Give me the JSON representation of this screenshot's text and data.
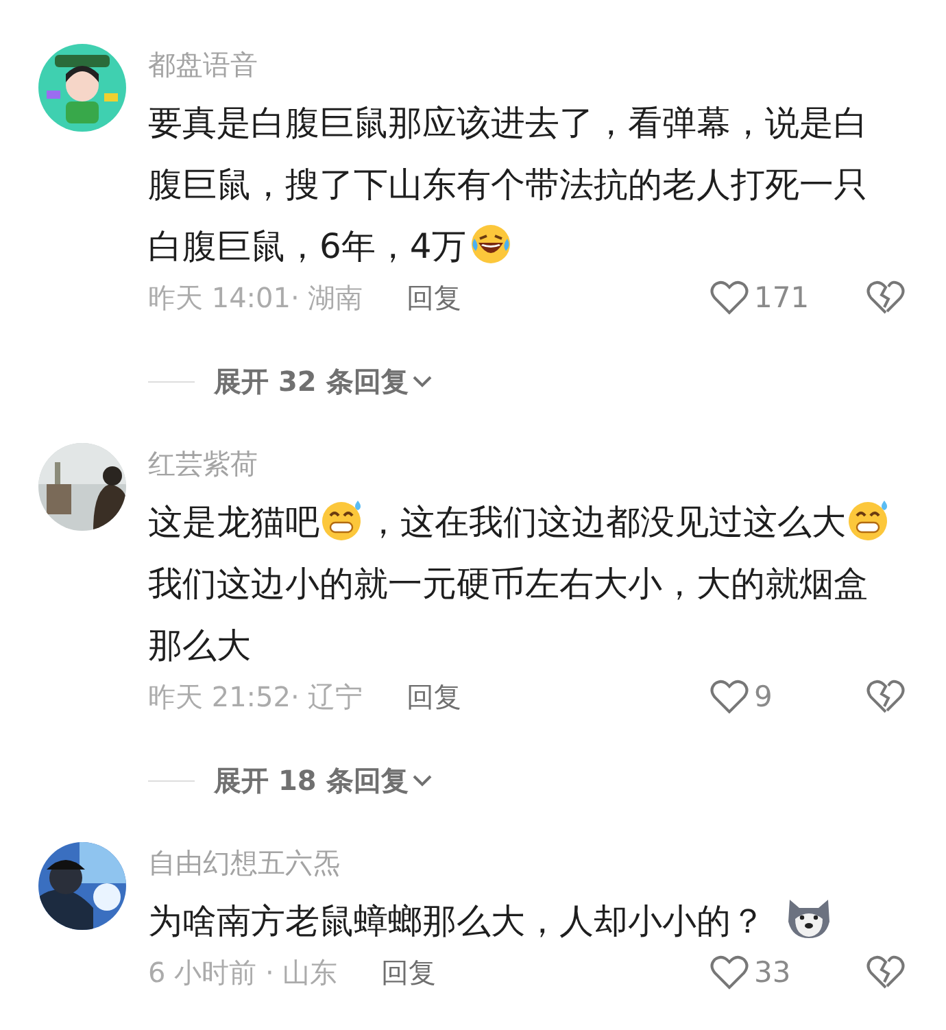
{
  "comments": [
    {
      "user": "都盘语音",
      "avatar": {
        "kind": "picture"
      },
      "body": [
        {
          "kind": "text",
          "text": "要真是白腹巨鼠那应该进去了，看弹幕，说是白腹巨鼠，搜了下山东有个带法抗的老人打死一只白腹巨鼠，6年，4万"
        },
        {
          "kind": "laugh-cry"
        }
      ],
      "meta": "昨天 14:01· 湖南",
      "reply": "回复",
      "likes": "171",
      "expand": "展开 32 条回复"
    },
    {
      "user": "红芸紫荷",
      "avatar": {
        "kind": "picture"
      },
      "body": [
        {
          "kind": "text",
          "text": "这是龙猫吧"
        },
        {
          "kind": "sweat-grin"
        },
        {
          "kind": "text",
          "text": "，这在我们这边都没见过这么大"
        },
        {
          "kind": "sweat-grin"
        },
        {
          "kind": "text",
          "text": "我们这边小的就一元硬币左右大小，大的就烟盒那么大"
        }
      ],
      "meta": "昨天 21:52· 辽宁",
      "reply": "回复",
      "likes": "9",
      "expand": "展开 18 条回复"
    },
    {
      "user": "自由幻想五六炁",
      "avatar": {
        "kind": "picture"
      },
      "body": [
        {
          "kind": "text",
          "text": "为啥南方老鼠蟑螂那么大，人却小小的？"
        },
        {
          "kind": "husky"
        }
      ],
      "meta": "6 小时前 · 山东",
      "reply": "回复",
      "likes": "33"
    }
  ]
}
